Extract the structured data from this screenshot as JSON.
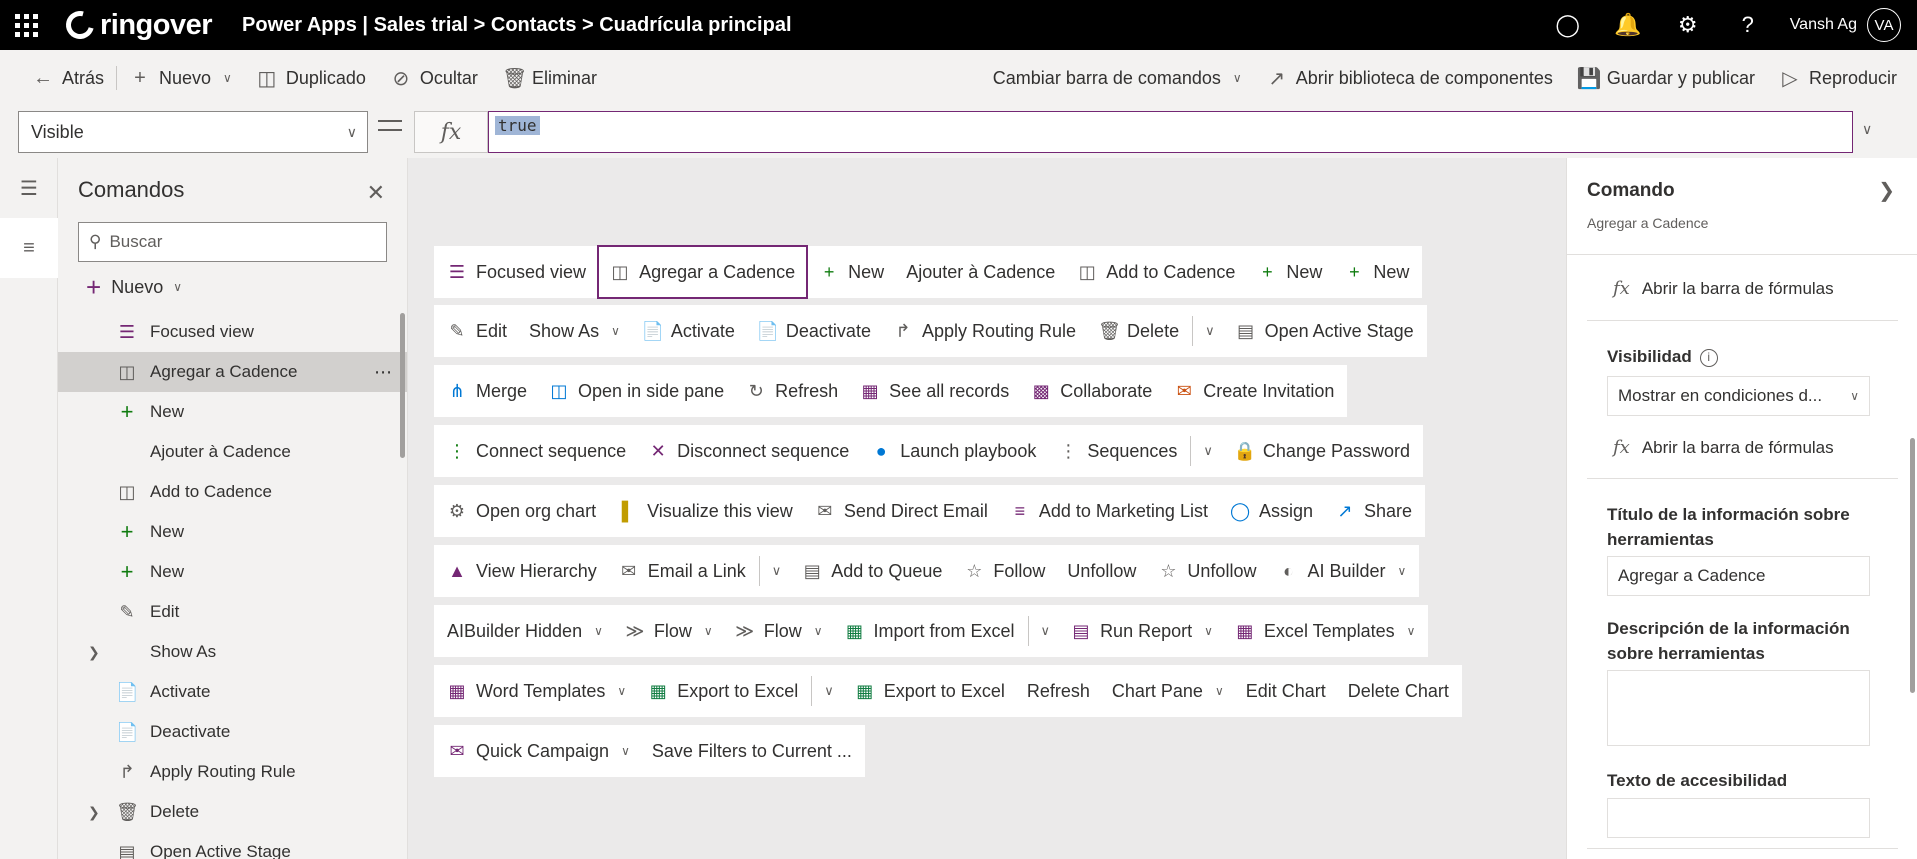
{
  "topbar": {
    "brand": "ringover",
    "title": "Power Apps  |  Sales trial > Contacts > Cuadrícula principal",
    "user_name": "Vansh Ag",
    "user_initials": "VA"
  },
  "commandbar": {
    "back": "Atrás",
    "new": "Nuevo",
    "duplicate": "Duplicado",
    "hide": "Ocultar",
    "delete": "Eliminar",
    "change_bar": "Cambiar barra de comandos",
    "open_library": "Abrir biblioteca de componentes",
    "save_publish": "Guardar y publicar",
    "play": "Reproducir"
  },
  "formula": {
    "property": "Visible",
    "fx": "fx",
    "value": "true"
  },
  "tree": {
    "title": "Comandos",
    "search_placeholder": "Buscar",
    "new_label": "Nuevo",
    "items": [
      {
        "label": "Focused view",
        "icon": "list-icon"
      },
      {
        "label": "Agregar a Cadence",
        "icon": "add-to-cadence-icon"
      },
      {
        "label": "New",
        "icon": "plus-icon"
      },
      {
        "label": "Ajouter à Cadence",
        "icon": ""
      },
      {
        "label": "Add to Cadence",
        "icon": "add-to-cadence-icon"
      },
      {
        "label": "New",
        "icon": "plus-icon"
      },
      {
        "label": "New",
        "icon": "plus-icon"
      },
      {
        "label": "Edit",
        "icon": "pencil-icon"
      },
      {
        "label": "Show As",
        "icon": ""
      },
      {
        "label": "Activate",
        "icon": "activate-icon"
      },
      {
        "label": "Deactivate",
        "icon": "deactivate-icon"
      },
      {
        "label": "Apply Routing Rule",
        "icon": "routing-icon"
      },
      {
        "label": "Delete",
        "icon": "trash-icon"
      },
      {
        "label": "Open Active Stage",
        "icon": "stage-icon"
      }
    ]
  },
  "canvas": {
    "row1": [
      "Focused view",
      "Agregar a Cadence",
      "New",
      "Ajouter à Cadence",
      "Add to Cadence",
      "New",
      "New"
    ],
    "row2": [
      "Edit",
      "Show As",
      "Activate",
      "Deactivate",
      "Apply Routing Rule",
      "Delete",
      "Open Active Stage"
    ],
    "row3": [
      "Merge",
      "Open in side pane",
      "Refresh",
      "See all records",
      "Collaborate",
      "Create Invitation"
    ],
    "row4": [
      "Connect sequence",
      "Disconnect sequence",
      "Launch playbook",
      "Sequences",
      "Change Password"
    ],
    "row5": [
      "Open org chart",
      "Visualize this view",
      "Send Direct Email",
      "Add to Marketing List",
      "Assign",
      "Share"
    ],
    "row6": [
      "View Hierarchy",
      "Email a Link",
      "Add to Queue",
      "Follow",
      "Unfollow",
      "Unfollow",
      "AI Builder"
    ],
    "row7": [
      "AIBuilder Hidden",
      "Flow",
      "Flow",
      "Import from Excel",
      "Run Report",
      "Excel Templates"
    ],
    "row8": [
      "Word Templates",
      "Export to Excel",
      "Export to Excel",
      "Refresh",
      "Chart Pane",
      "Edit Chart",
      "Delete Chart"
    ],
    "row9": [
      "Quick Campaign",
      "Save Filters to Current ..."
    ]
  },
  "props": {
    "title": "Comando",
    "subtitle": "Agregar a Cadence",
    "formula_link": "Abrir la barra de fórmulas",
    "visibility_label": "Visibilidad",
    "visibility_value": "Mostrar en condiciones d...",
    "formula_link2": "Abrir la barra de fórmulas",
    "tooltip_title_label": "Título de la información sobre herramientas",
    "tooltip_title_value": "Agregar a Cadence",
    "tooltip_desc_label": "Descripción de la información sobre herramientas",
    "tooltip_desc_value": "",
    "accessibility_label": "Texto de accesibilidad",
    "accessibility_value": ""
  },
  "colors": {
    "accent": "#742774",
    "topbar": "#000000",
    "green": "#107c10"
  }
}
